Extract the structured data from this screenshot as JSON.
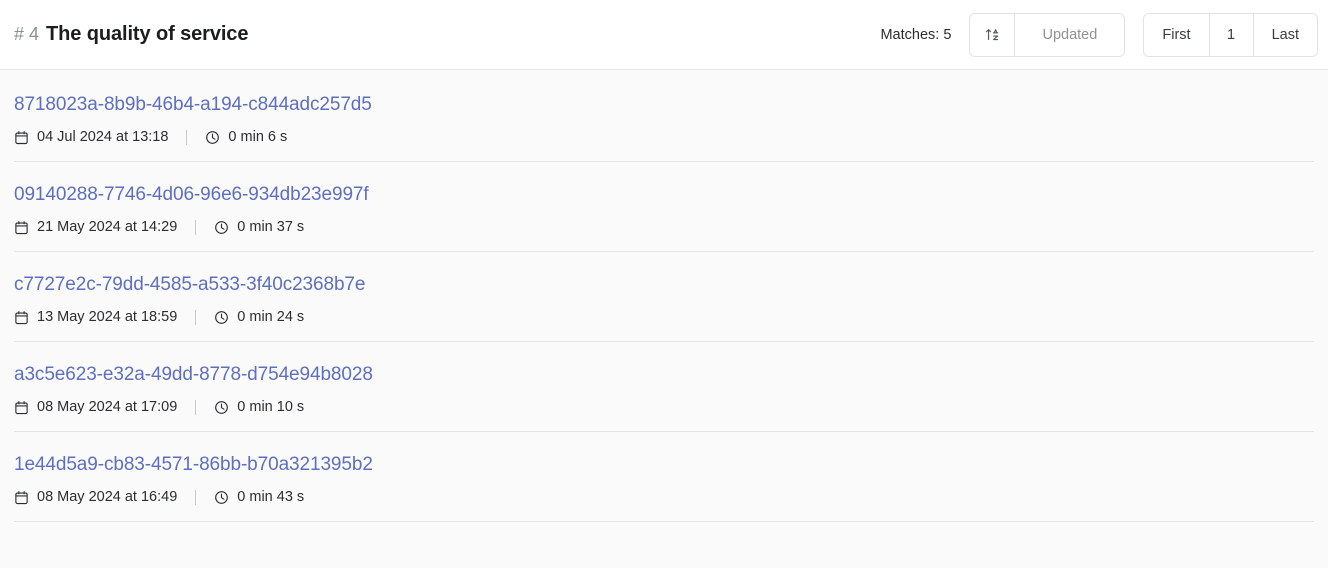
{
  "header": {
    "number_prefix": "# 4",
    "title": "The quality of service",
    "matches_label": "Matches: 5",
    "sort": {
      "icon": "sort-ascending-icon",
      "field_label": "Updated"
    },
    "pagination": {
      "first_label": "First",
      "current_page": "1",
      "last_label": "Last"
    }
  },
  "colors": {
    "link": "#5e6fc0",
    "header_bg": "#ffffff",
    "page_bg": "#fafafa",
    "divider": "#e4e4e6",
    "active_page_bg": "#ededed",
    "muted_text": "#8f9296"
  },
  "icons": {
    "calendar": "calendar-icon",
    "clock": "clock-icon"
  },
  "results": [
    {
      "id": "8718023a-8b9b-46b4-a194-c844adc257d5",
      "date": "04 Jul 2024 at 13:18",
      "duration": "0 min 6 s"
    },
    {
      "id": "09140288-7746-4d06-96e6-934db23e997f",
      "date": "21 May 2024 at 14:29",
      "duration": "0 min 37 s"
    },
    {
      "id": "c7727e2c-79dd-4585-a533-3f40c2368b7e",
      "date": "13 May 2024 at 18:59",
      "duration": "0 min 24 s"
    },
    {
      "id": "a3c5e623-e32a-49dd-8778-d754e94b8028",
      "date": "08 May 2024 at 17:09",
      "duration": "0 min 10 s"
    },
    {
      "id": "1e44d5a9-cb83-4571-86bb-b70a321395b2",
      "date": "08 May 2024 at 16:49",
      "duration": "0 min 43 s"
    }
  ]
}
